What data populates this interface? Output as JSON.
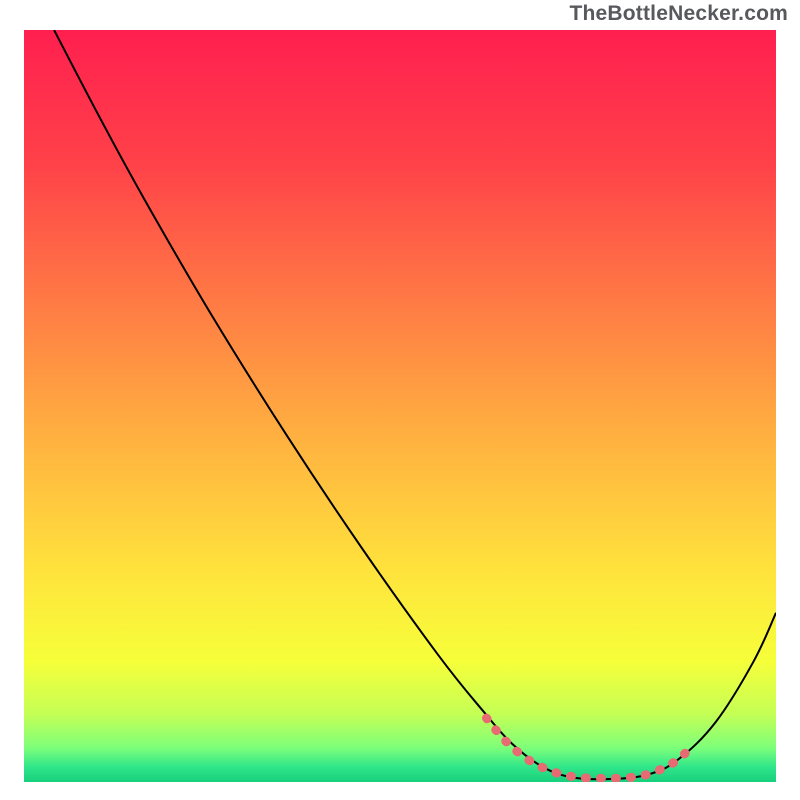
{
  "watermark": "TheBottleNecker.com",
  "chart_data": {
    "type": "line",
    "title": "",
    "xlabel": "",
    "ylabel": "",
    "xlim": [
      0,
      100
    ],
    "ylim": [
      0,
      100
    ],
    "grid": false,
    "legend": false,
    "background_gradient": {
      "stops": [
        {
          "offset": 0.0,
          "color": "#ff1f4f"
        },
        {
          "offset": 0.18,
          "color": "#ff4249"
        },
        {
          "offset": 0.38,
          "color": "#ff8044"
        },
        {
          "offset": 0.55,
          "color": "#ffb340"
        },
        {
          "offset": 0.72,
          "color": "#ffe33c"
        },
        {
          "offset": 0.84,
          "color": "#f6ff3a"
        },
        {
          "offset": 0.91,
          "color": "#c4ff55"
        },
        {
          "offset": 0.955,
          "color": "#7cff7a"
        },
        {
          "offset": 0.98,
          "color": "#30e68a"
        },
        {
          "offset": 1.0,
          "color": "#18cf7c"
        }
      ]
    },
    "series": [
      {
        "name": "bottleneck-curve",
        "stroke": "#000000",
        "stroke_width": 2,
        "points": [
          {
            "x": 4.0,
            "y": 100.0
          },
          {
            "x": 10.0,
            "y": 88.5
          },
          {
            "x": 16.0,
            "y": 77.5
          },
          {
            "x": 25.0,
            "y": 62.0
          },
          {
            "x": 35.0,
            "y": 46.0
          },
          {
            "x": 45.0,
            "y": 31.0
          },
          {
            "x": 55.0,
            "y": 17.0
          },
          {
            "x": 61.0,
            "y": 9.5
          },
          {
            "x": 65.0,
            "y": 5.0
          },
          {
            "x": 69.0,
            "y": 2.0
          },
          {
            "x": 73.0,
            "y": 0.6
          },
          {
            "x": 78.0,
            "y": 0.4
          },
          {
            "x": 83.0,
            "y": 1.0
          },
          {
            "x": 87.0,
            "y": 3.0
          },
          {
            "x": 92.0,
            "y": 8.0
          },
          {
            "x": 97.0,
            "y": 16.0
          },
          {
            "x": 100.0,
            "y": 22.5
          }
        ]
      },
      {
        "name": "optimal-range-highlight",
        "stroke": "#e86a72",
        "stroke_width": 9,
        "stroke_linecap": "round",
        "dash": "1 14",
        "points": [
          {
            "x": 61.5,
            "y": 8.5
          },
          {
            "x": 64.0,
            "y": 5.5
          },
          {
            "x": 67.0,
            "y": 3.0
          },
          {
            "x": 70.0,
            "y": 1.5
          },
          {
            "x": 73.0,
            "y": 0.7
          },
          {
            "x": 76.0,
            "y": 0.5
          },
          {
            "x": 79.0,
            "y": 0.5
          },
          {
            "x": 82.0,
            "y": 0.8
          },
          {
            "x": 84.5,
            "y": 1.6
          },
          {
            "x": 87.0,
            "y": 3.0
          },
          {
            "x": 89.0,
            "y": 5.0
          }
        ]
      }
    ]
  }
}
